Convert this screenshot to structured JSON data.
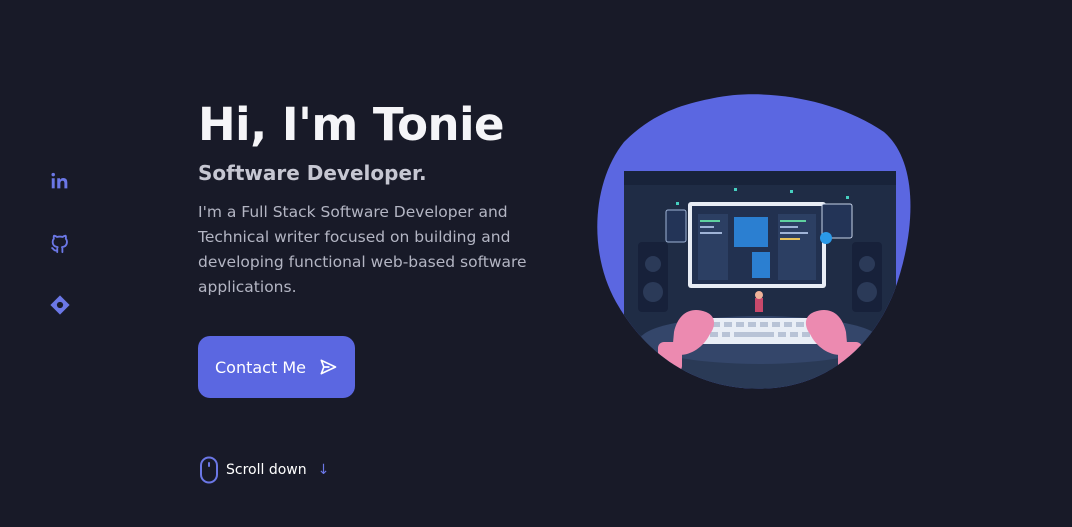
{
  "hero": {
    "title": "Hi, I'm Tonie",
    "subtitle": "Software Developer.",
    "description": "I'm a Full Stack Software Developer and Technical writer focused on building and developing functional web-based software applications.",
    "contact_label": "Contact Me"
  },
  "social": {
    "icons": [
      "linkedin-icon",
      "github-icon",
      "hashnode-icon"
    ]
  },
  "scroll": {
    "label": "Scroll down",
    "arrow": "↓"
  },
  "colors": {
    "background": "#181a28",
    "accent": "#5b67e1",
    "text": "#f5f5f8",
    "muted": "#b3b5c3"
  }
}
